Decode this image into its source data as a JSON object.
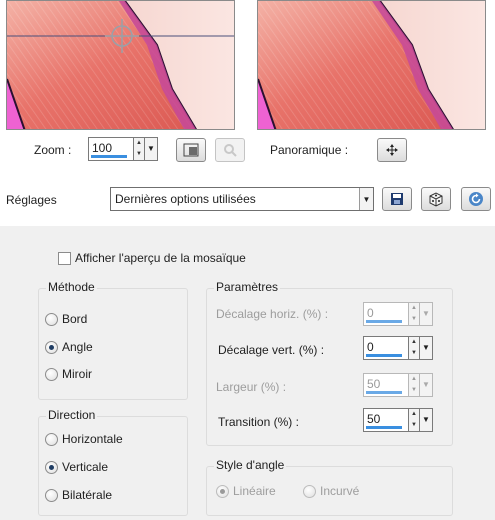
{
  "zoom": {
    "label": "Zoom :",
    "value": "100"
  },
  "panoramique": {
    "label": "Panoramique :"
  },
  "reglages": {
    "label": "Réglages",
    "value": "Dernières options utilisées"
  },
  "tile_preview": {
    "label": "Afficher l'aperçu de la mosaïque",
    "checked": false
  },
  "methode": {
    "title": "Méthode",
    "options": [
      "Bord",
      "Angle",
      "Miroir"
    ],
    "selected": "Angle"
  },
  "direction": {
    "title": "Direction",
    "options": [
      "Horizontale",
      "Verticale",
      "Bilatérale"
    ],
    "selected": "Verticale"
  },
  "parametres": {
    "title": "Paramètres",
    "decalage_horiz": {
      "label": "Décalage horiz. (%) :",
      "value": "0",
      "enabled": false
    },
    "decalage_vert": {
      "label": "Décalage vert. (%) :",
      "value": "0",
      "enabled": true
    },
    "largeur": {
      "label": "Largeur (%) :",
      "value": "50",
      "enabled": false
    },
    "transition": {
      "label": "Transition (%) :",
      "value": "50",
      "enabled": true
    }
  },
  "style_angle": {
    "title": "Style d'angle",
    "options": [
      "Linéaire",
      "Incurvé"
    ],
    "selected": "Linéaire",
    "enabled": false
  },
  "colors": {
    "accent": "#3a8fe0",
    "panel": "#f0f0f0",
    "salmon": "#e87468",
    "magenta": "#e95fd0"
  }
}
